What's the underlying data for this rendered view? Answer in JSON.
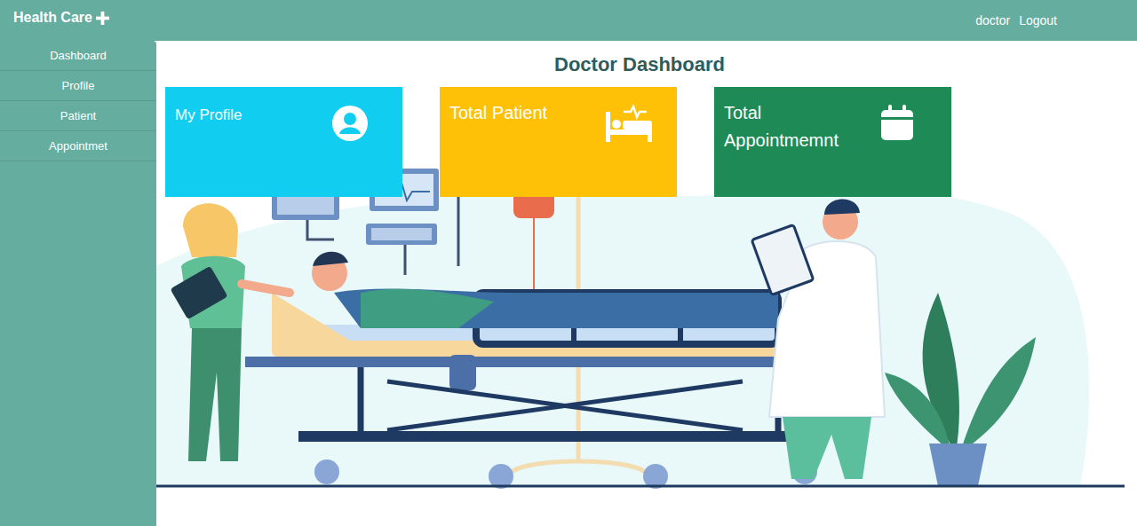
{
  "brand": {
    "title": "Health Care"
  },
  "user": {
    "name": "doctor",
    "logout": "Logout"
  },
  "sidebar": {
    "items": [
      {
        "label": "Dashboard"
      },
      {
        "label": "Profile"
      },
      {
        "label": "Patient"
      },
      {
        "label": "Appointmet"
      }
    ]
  },
  "page": {
    "title": "Doctor Dashboard"
  },
  "cards": [
    {
      "kind": "profile",
      "label": "My Profile",
      "color": "#11cdef"
    },
    {
      "kind": "patients",
      "label": "Total Patient",
      "color": "#ffc107"
    },
    {
      "kind": "appointments",
      "label": "Total Appointmemnt",
      "color": "#1e8b57"
    }
  ]
}
